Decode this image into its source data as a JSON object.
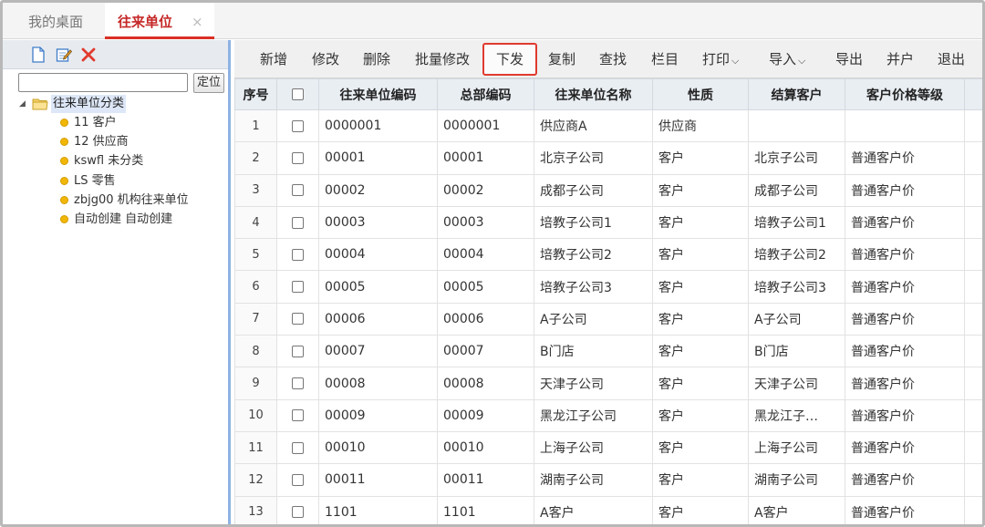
{
  "tabs": {
    "home_label": "我的桌面",
    "active_label": "往来单位",
    "close_glyph": "×"
  },
  "left_panel": {
    "toolbar_icons": [
      "new-document-icon",
      "edit-icon",
      "delete-icon"
    ],
    "locate_input_value": "",
    "locate_button": "定位",
    "tree": {
      "root_label": "往来单位分类",
      "items": [
        "11 客户",
        "12 供应商",
        "kswfl 未分类",
        "LS 零售",
        "zbjg00 机构往来单位",
        "自动创建 自动创建"
      ]
    }
  },
  "toolbar": {
    "add": "新增",
    "modify": "修改",
    "delete": "删除",
    "batch_modify": "批量修改",
    "dispatch": "下发",
    "copy": "复制",
    "search": "查找",
    "columns": "栏目",
    "print": "打印",
    "import": "导入",
    "export": "导出",
    "merge": "并户",
    "exit": "退出",
    "highlight_color": "#e03a2f"
  },
  "table": {
    "headers": [
      "序号",
      "",
      "往来单位编码",
      "总部编码",
      "往来单位名称",
      "性质",
      "结算客户",
      "客户价格等级"
    ],
    "rows": [
      [
        "1",
        "0000001",
        "0000001",
        "供应商A",
        "供应商",
        "",
        ""
      ],
      [
        "2",
        "00001",
        "00001",
        "北京子公司",
        "客户",
        "北京子公司",
        "普通客户价"
      ],
      [
        "3",
        "00002",
        "00002",
        "成都子公司",
        "客户",
        "成都子公司",
        "普通客户价"
      ],
      [
        "4",
        "00003",
        "00003",
        "培教子公司1",
        "客户",
        "培教子公司1",
        "普通客户价"
      ],
      [
        "5",
        "00004",
        "00004",
        "培教子公司2",
        "客户",
        "培教子公司2",
        "普通客户价"
      ],
      [
        "6",
        "00005",
        "00005",
        "培教子公司3",
        "客户",
        "培教子公司3",
        "普通客户价"
      ],
      [
        "7",
        "00006",
        "00006",
        "A子公司",
        "客户",
        "A子公司",
        "普通客户价"
      ],
      [
        "8",
        "00007",
        "00007",
        "B门店",
        "客户",
        "B门店",
        "普通客户价"
      ],
      [
        "9",
        "00008",
        "00008",
        "天津子公司",
        "客户",
        "天津子公司",
        "普通客户价"
      ],
      [
        "10",
        "00009",
        "00009",
        "黑龙江子公司",
        "客户",
        "黑龙江子…",
        "普通客户价"
      ],
      [
        "11",
        "00010",
        "00010",
        "上海子公司",
        "客户",
        "上海子公司",
        "普通客户价"
      ],
      [
        "12",
        "00011",
        "00011",
        "湖南子公司",
        "客户",
        "湖南子公司",
        "普通客户价"
      ],
      [
        "13",
        "1101",
        "1101",
        "A客户",
        "客户",
        "A客户",
        "普通客户价"
      ]
    ]
  }
}
